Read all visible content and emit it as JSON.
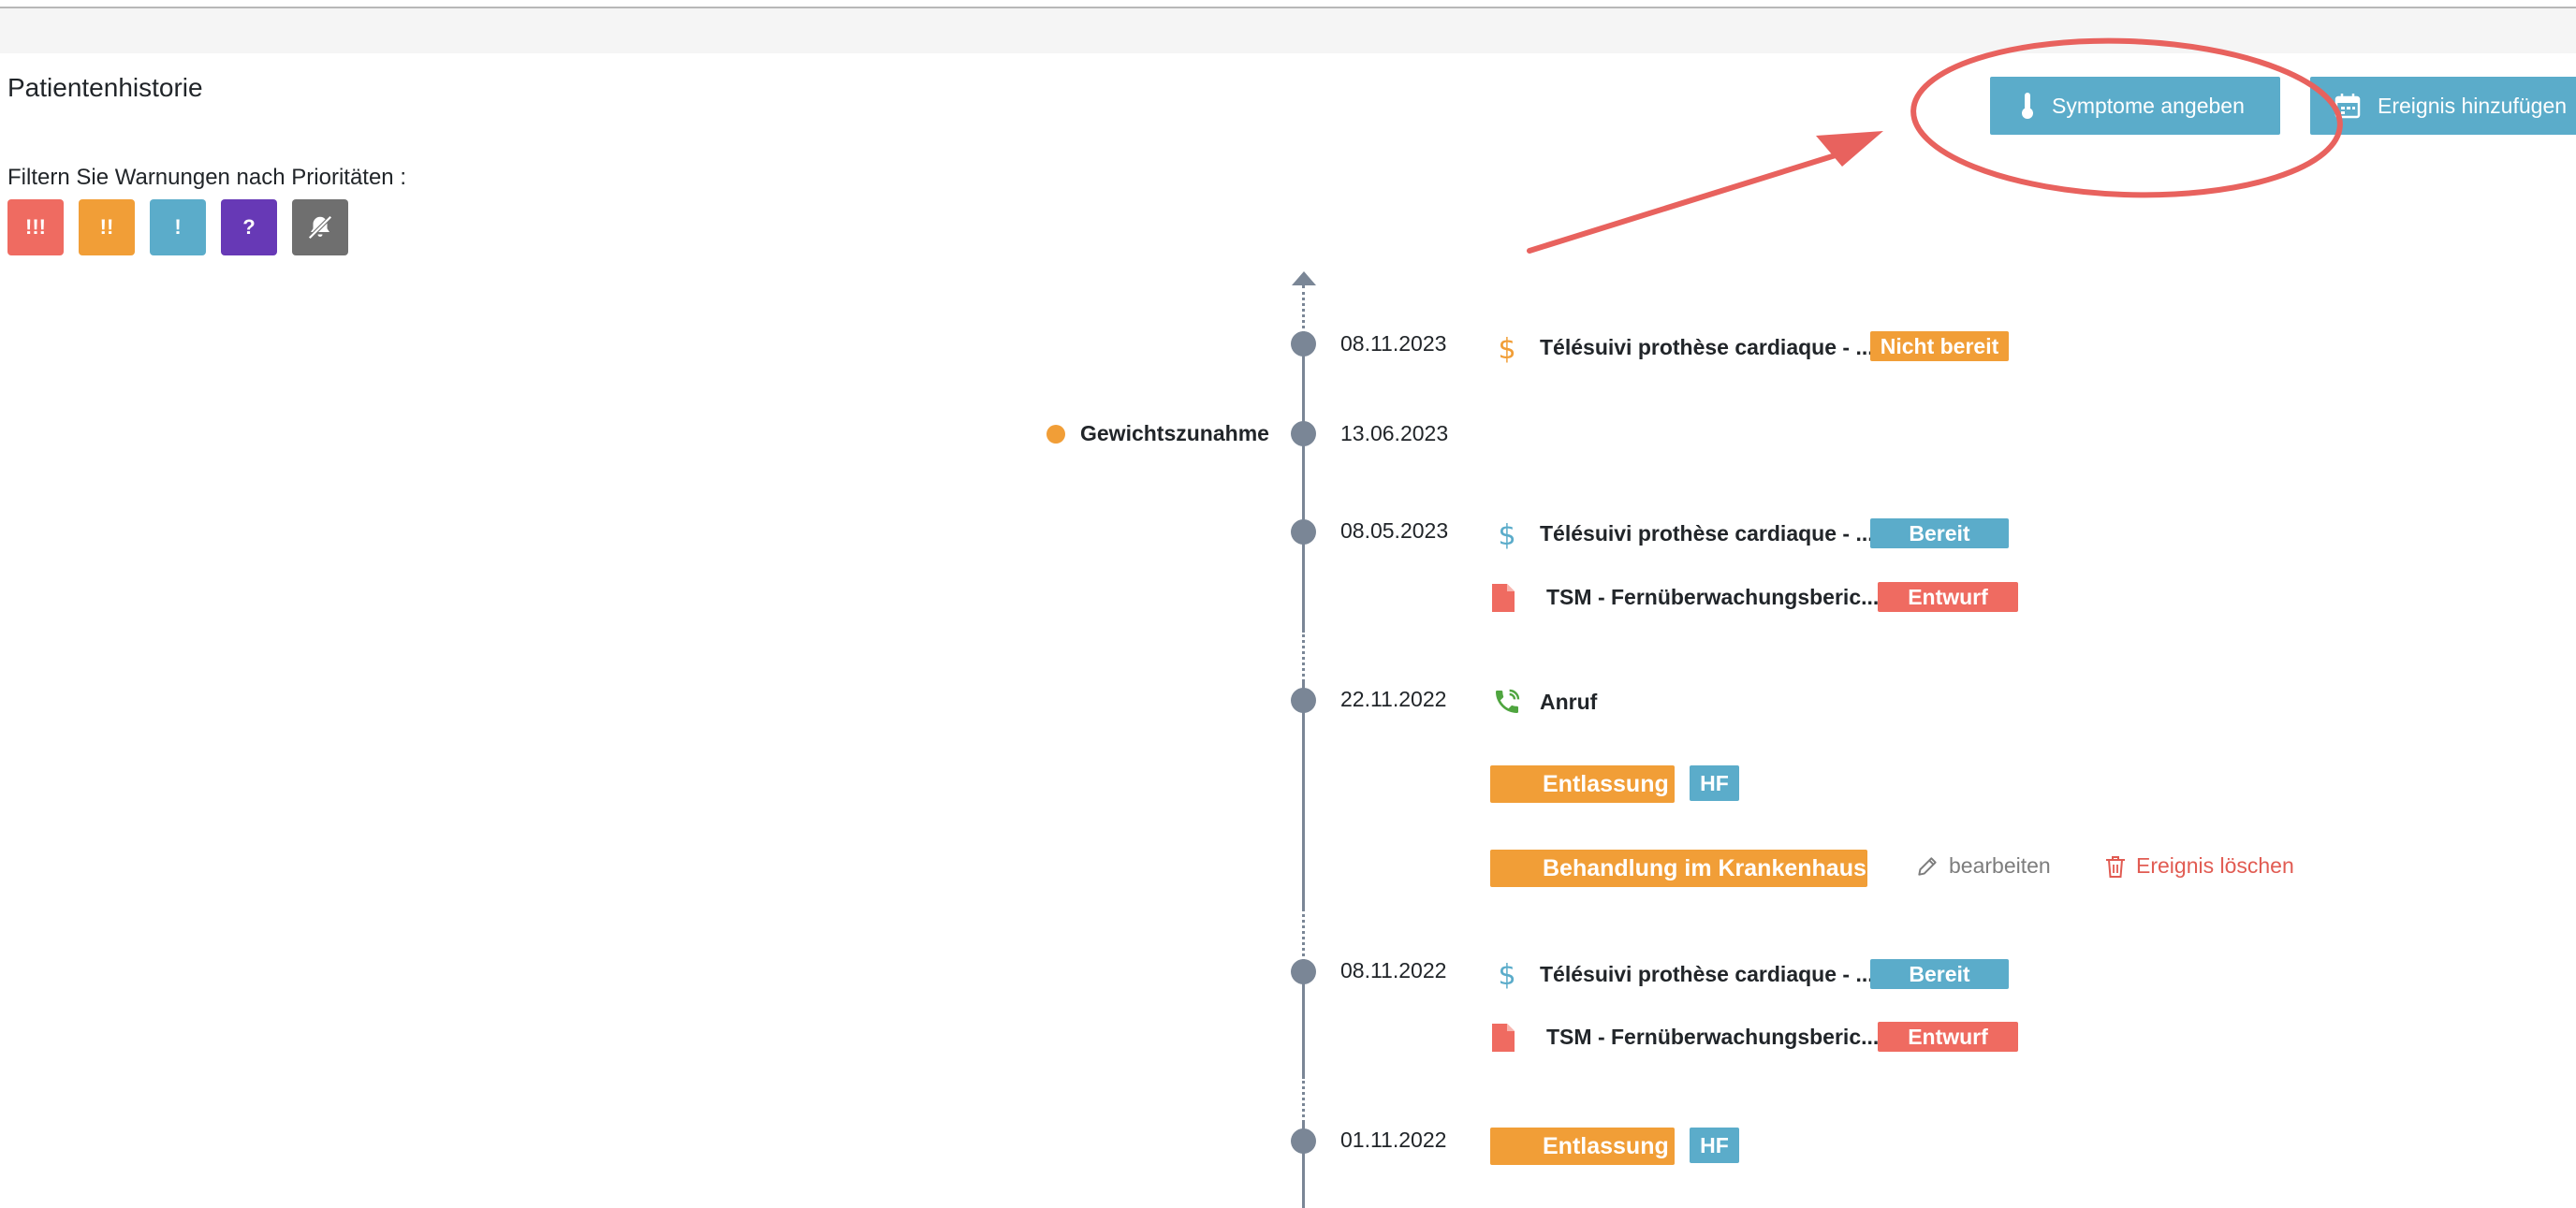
{
  "page": {
    "title": "Patientenhistorie",
    "filter_label": "Filtern Sie Warnungen nach Prioritäten :"
  },
  "filters": [
    {
      "label": "!!!",
      "color": "#ef6b61"
    },
    {
      "label": "!!",
      "color": "#f19e37"
    },
    {
      "label": "!",
      "color": "#5bacca"
    },
    {
      "label": "?",
      "color": "#6739b6"
    },
    {
      "icon": "muted-bell-icon",
      "color": "#6f6f6f"
    }
  ],
  "header_buttons": {
    "symptoms": {
      "label": "Symptome angeben",
      "icon": "thermometer-icon"
    },
    "add_event": {
      "label": "Ereignis hinzufügen",
      "icon": "calendar-icon"
    }
  },
  "colors": {
    "accent": "#5bacca",
    "warning": "#f19e37",
    "danger": "#ef6b61",
    "timeline": "#7a8696",
    "annotation": "#e8625e"
  },
  "timeline": {
    "entries": [
      {
        "date": "08.11.2023",
        "items": [
          {
            "icon": "dollar-icon",
            "title": "Télésuivi prothèse cardiaque - ...",
            "status": "Nicht bereit"
          }
        ]
      },
      {
        "date": "13.06.2023",
        "side_label": "Gewichtszunahme"
      },
      {
        "date": "08.05.2023",
        "items": [
          {
            "icon": "dollar-icon",
            "title": "Télésuivi prothèse cardiaque - ...",
            "status": "Bereit"
          },
          {
            "icon": "document-icon",
            "title": "TSM - Fernüberwachungsberic...",
            "status": "Entwurf"
          }
        ]
      },
      {
        "date": "22.11.2022",
        "items": [
          {
            "icon": "phone-icon",
            "title": "Anruf"
          }
        ],
        "pills": [
          {
            "label": "Entlassung",
            "tag": "HF"
          },
          {
            "label": "Behandlung im Krankenhaus"
          }
        ],
        "actions": {
          "edit": "bearbeiten",
          "delete": "Ereignis löschen"
        }
      },
      {
        "date": "08.11.2022",
        "items": [
          {
            "icon": "dollar-icon",
            "title": "Télésuivi prothèse cardiaque - ...",
            "status": "Bereit"
          },
          {
            "icon": "document-icon",
            "title": "TSM - Fernüberwachungsberic...",
            "status": "Entwurf"
          }
        ]
      },
      {
        "date": "01.11.2022",
        "pills": [
          {
            "label": "Entlassung",
            "tag": "HF"
          }
        ]
      }
    ]
  }
}
